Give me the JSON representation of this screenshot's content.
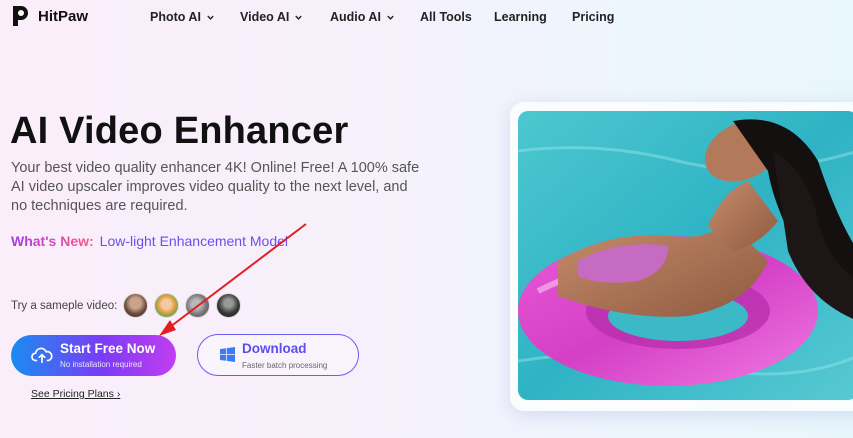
{
  "brand": {
    "name": "HitPaw"
  },
  "nav": {
    "items": [
      {
        "label": "Photo AI",
        "dropdown": true
      },
      {
        "label": "Video AI",
        "dropdown": true
      },
      {
        "label": "Audio AI",
        "dropdown": true
      },
      {
        "label": "All Tools",
        "dropdown": false
      },
      {
        "label": "Learning",
        "dropdown": false
      },
      {
        "label": "Pricing",
        "dropdown": false
      }
    ]
  },
  "hero": {
    "title": "AI Video Enhancer",
    "description": "Your best video quality enhancer 4K! Online! Free! A 100% safe AI video upscaler improves video quality to the next level, and no techniques are required.",
    "whats_new_label": "What's New:",
    "whats_new_value": "Low-light Enhancement Model",
    "sample_label": "Try a sameple video:",
    "samples": [
      "sample-video-1",
      "sample-video-2",
      "sample-video-3",
      "sample-video-4"
    ]
  },
  "cta": {
    "primary_label": "Start Free Now",
    "primary_sub": "No installation required",
    "secondary_label": "Download",
    "secondary_sub": "Faster batch processing",
    "pricing_link": "See Pricing Plans"
  },
  "icons": {
    "upload": "cloud-upload-icon",
    "windows": "windows-icon"
  },
  "colors": {
    "accent": "#6c5cf5",
    "primary_gradient_start": "#1a8cf0",
    "primary_gradient_end": "#c23df0",
    "annotation_arrow": "#e02020"
  }
}
